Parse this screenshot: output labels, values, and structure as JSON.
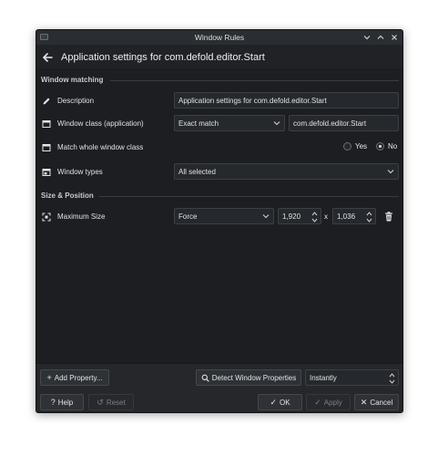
{
  "window": {
    "title": "Window Rules"
  },
  "header": {
    "title": "Application settings for com.defold.editor.Start"
  },
  "sections": {
    "window_matching": "Window matching",
    "size_position": "Size & Position"
  },
  "rows": {
    "description": {
      "label": "Description",
      "value": "Application settings for com.defold.editor.Start"
    },
    "window_class": {
      "label": "Window class (application)",
      "match": "Exact match",
      "value": "com.defold.editor.Start"
    },
    "whole_class": {
      "label": "Match whole window class",
      "yes": "Yes",
      "no": "No",
      "selected": "No"
    },
    "window_types": {
      "label": "Window types",
      "value": "All selected"
    },
    "max_size": {
      "label": "Maximum Size",
      "policy": "Force",
      "width": "1,920",
      "separator": "x",
      "height": "1,036"
    }
  },
  "footer": {
    "add_property": "Add Property...",
    "detect": "Detect Window Properties",
    "delay": "Instantly",
    "help": "Help",
    "reset": "Reset",
    "ok": "OK",
    "apply": "Apply",
    "cancel": "Cancel"
  },
  "icons": {
    "back": "arrow-left-icon",
    "description": "pencil-icon",
    "window": "window-icon",
    "size": "resize-icon",
    "delete": "trash-icon",
    "help": "question-icon",
    "reset": "reset-icon",
    "ok": "checkmark-icon",
    "apply": "checkmark-icon",
    "cancel": "close-icon"
  }
}
